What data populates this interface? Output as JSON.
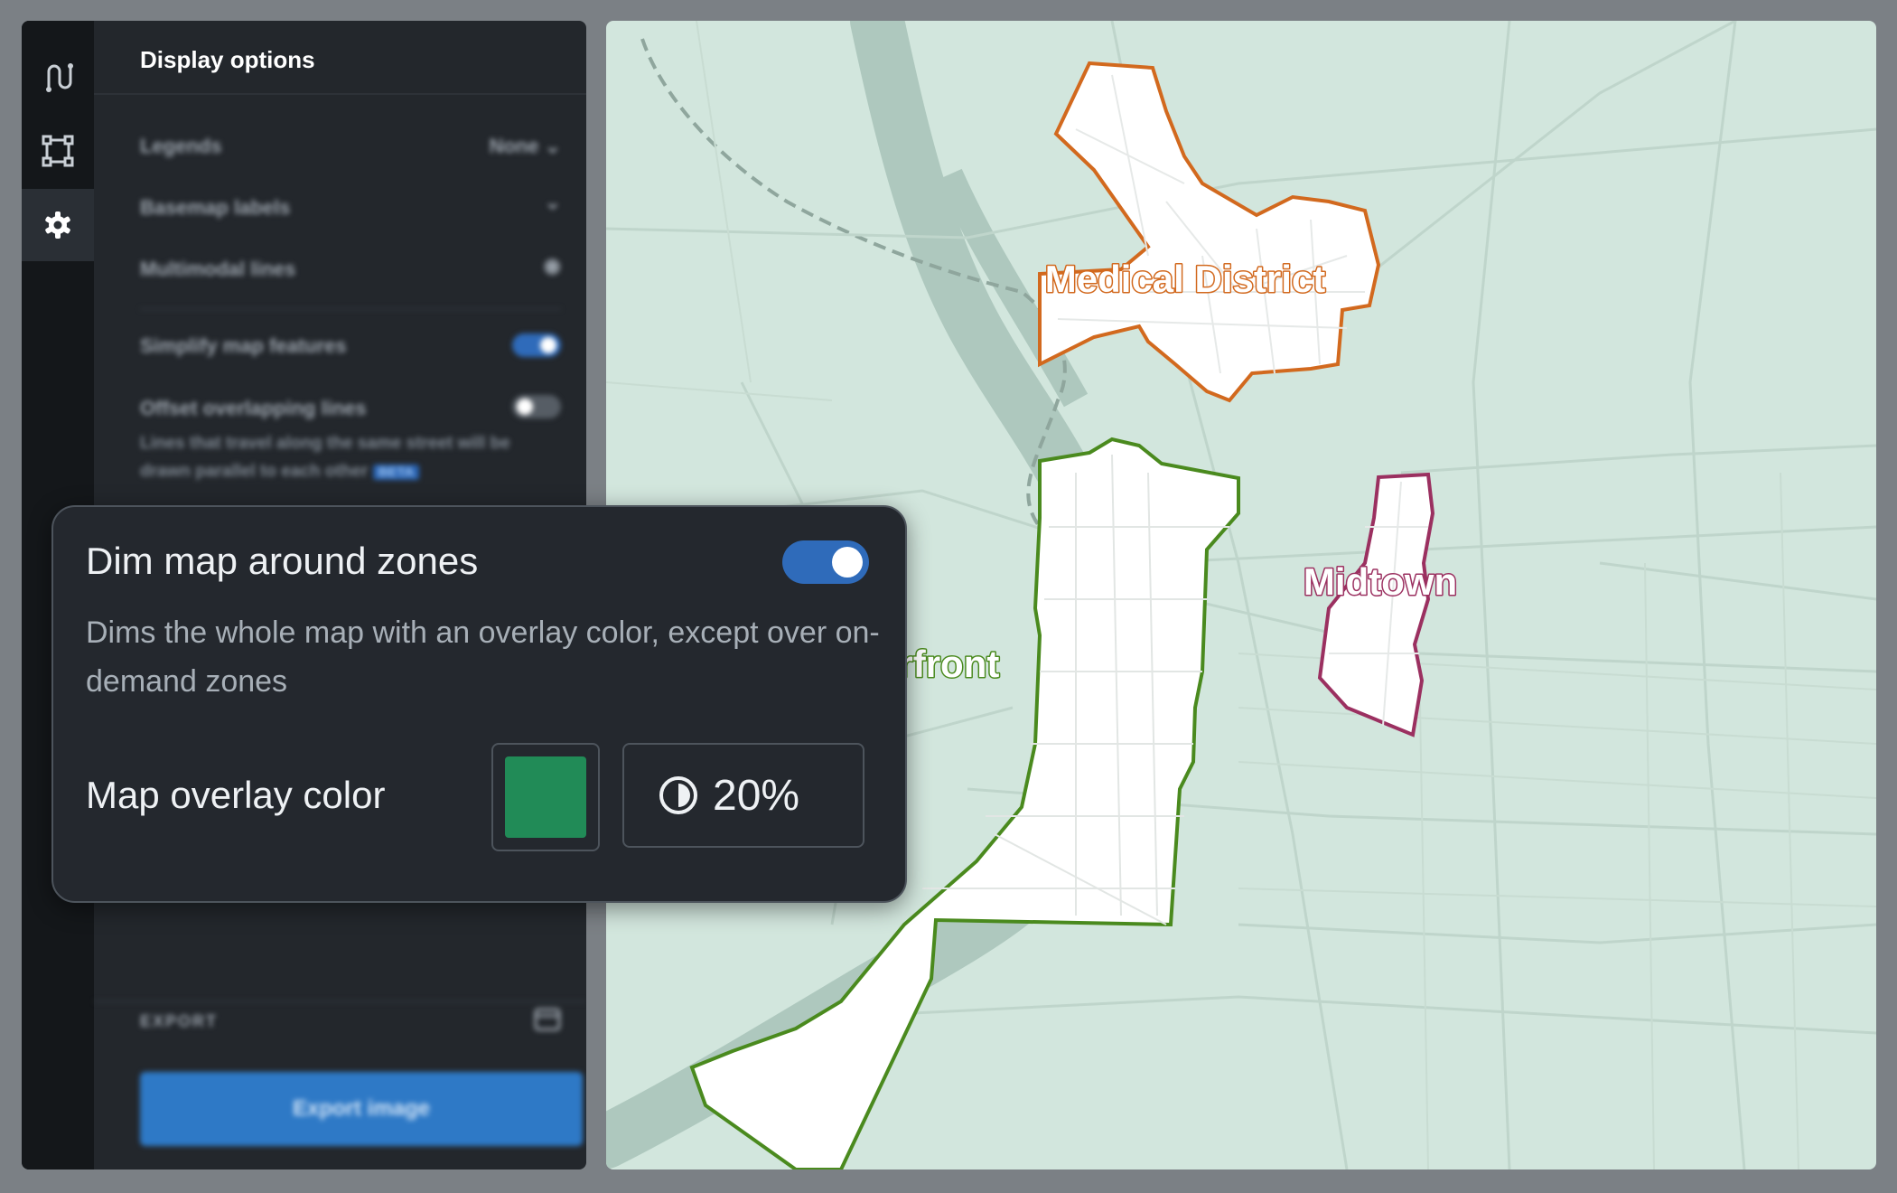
{
  "sidebar": {
    "rail": [
      {
        "icon": "route-icon",
        "active": false
      },
      {
        "icon": "zone-shape-icon",
        "active": false
      },
      {
        "icon": "gear-icon",
        "active": true
      }
    ],
    "title": "Display options",
    "options": {
      "legends_label": "Legends",
      "legends_value": "None",
      "basemap_labels_label": "Basemap labels",
      "multimodal_lines_label": "Multimodal lines",
      "simplify_label": "Simplify map features",
      "simplify_on": true,
      "offset_label": "Offset overlapping lines",
      "offset_on": false,
      "offset_note": "Lines that travel along the same street will be drawn parallel to each other",
      "offset_note_tag": "BETA"
    },
    "export": {
      "section_label": "EXPORT",
      "button_label": "Export image"
    }
  },
  "popover": {
    "title": "Dim map around zones",
    "toggle_on": true,
    "description": "Dims the whole map with an overlay color, except over on-demand zones",
    "overlay_color_label": "Map overlay color",
    "overlay_color": "#218b57",
    "opacity_value": "20%"
  },
  "map": {
    "dim_tint": "#d2e6dd",
    "zones": [
      {
        "name": "Medical District",
        "color": "#d2691e"
      },
      {
        "name": "Riverfront",
        "color": "#4a8a1e"
      },
      {
        "name": "Midtown",
        "color": "#9b3060"
      }
    ]
  }
}
